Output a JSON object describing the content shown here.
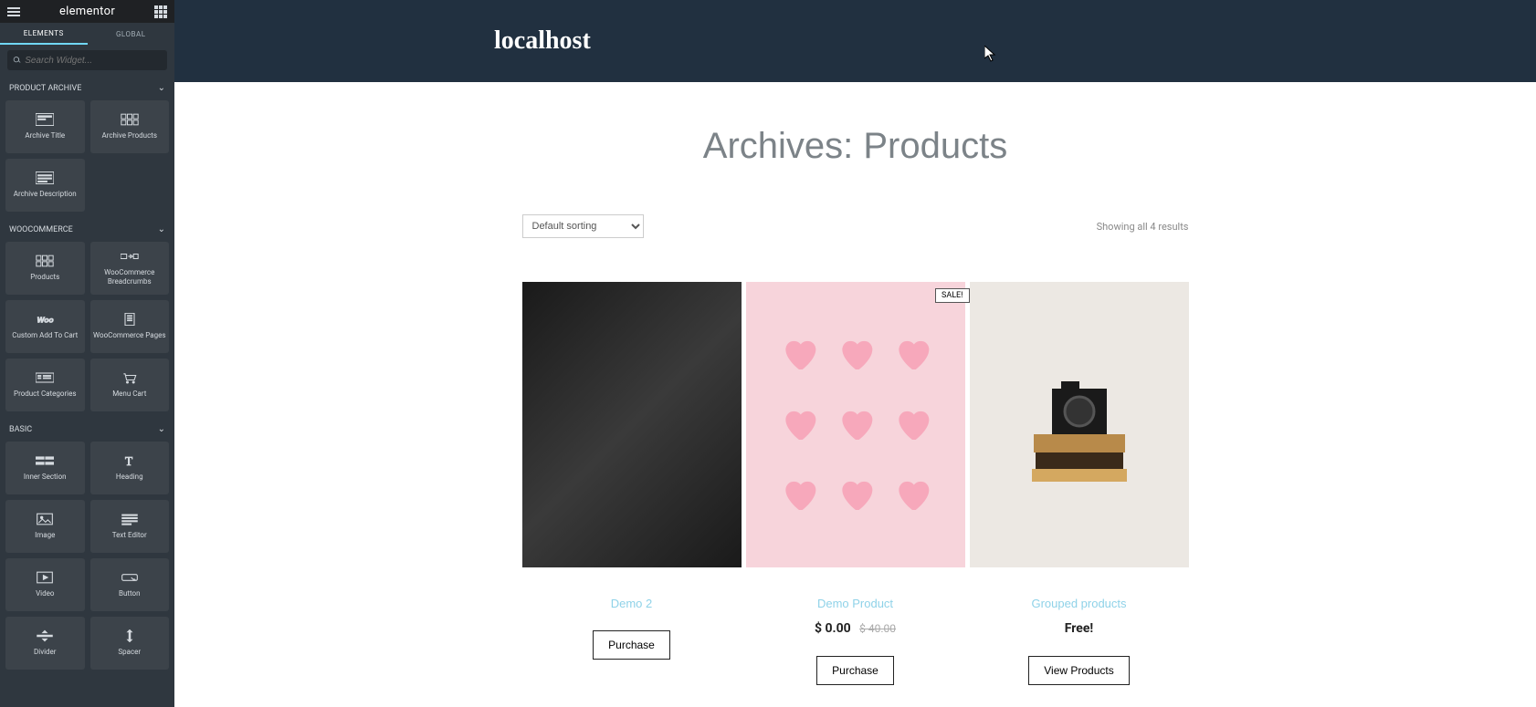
{
  "sidebar": {
    "brand": "elementor",
    "tabs": {
      "elements": "ELEMENTS",
      "global": "GLOBAL"
    },
    "search_placeholder": "Search Widget...",
    "categories": [
      {
        "name": "PRODUCT ARCHIVE",
        "widgets": [
          {
            "id": "archive-title",
            "label": "Archive Title",
            "icon": "title"
          },
          {
            "id": "archive-products",
            "label": "Archive Products",
            "icon": "grid"
          },
          {
            "id": "archive-description",
            "label": "Archive Description",
            "icon": "desc"
          }
        ]
      },
      {
        "name": "WOOCOMMERCE",
        "widgets": [
          {
            "id": "products",
            "label": "Products",
            "icon": "grid"
          },
          {
            "id": "wc-breadcrumbs",
            "label": "WooCommerce Breadcrumbs",
            "icon": "breadcrumb"
          },
          {
            "id": "custom-add-to-cart",
            "label": "Custom Add To Cart",
            "icon": "cart"
          },
          {
            "id": "wc-pages",
            "label": "WooCommerce Pages",
            "icon": "page"
          },
          {
            "id": "product-categories",
            "label": "Product Categories",
            "icon": "categories"
          },
          {
            "id": "menu-cart",
            "label": "Menu Cart",
            "icon": "menucart"
          }
        ]
      },
      {
        "name": "BASIC",
        "widgets": [
          {
            "id": "inner-section",
            "label": "Inner Section",
            "icon": "section"
          },
          {
            "id": "heading",
            "label": "Heading",
            "icon": "heading"
          },
          {
            "id": "image",
            "label": "Image",
            "icon": "image"
          },
          {
            "id": "text-editor",
            "label": "Text Editor",
            "icon": "text"
          },
          {
            "id": "video",
            "label": "Video",
            "icon": "video"
          },
          {
            "id": "button",
            "label": "Button",
            "icon": "button"
          },
          {
            "id": "divider",
            "label": "Divider",
            "icon": "divider"
          },
          {
            "id": "spacer",
            "label": "Spacer",
            "icon": "spacer"
          }
        ]
      }
    ]
  },
  "preview": {
    "site_title": "localhost",
    "page_title": "Archives: Products",
    "sort_label": "Default sorting",
    "result_count": "Showing all 4 results",
    "sale_badge": "SALE!",
    "products": [
      {
        "name": "Demo 2",
        "price": "",
        "button": "Purchase"
      },
      {
        "name": "Demo Product",
        "price": "$ 0.00",
        "old_price": "$ 40.00",
        "button": "Purchase"
      },
      {
        "name": "Grouped products",
        "price": "Free!",
        "button": "View Products"
      }
    ]
  }
}
